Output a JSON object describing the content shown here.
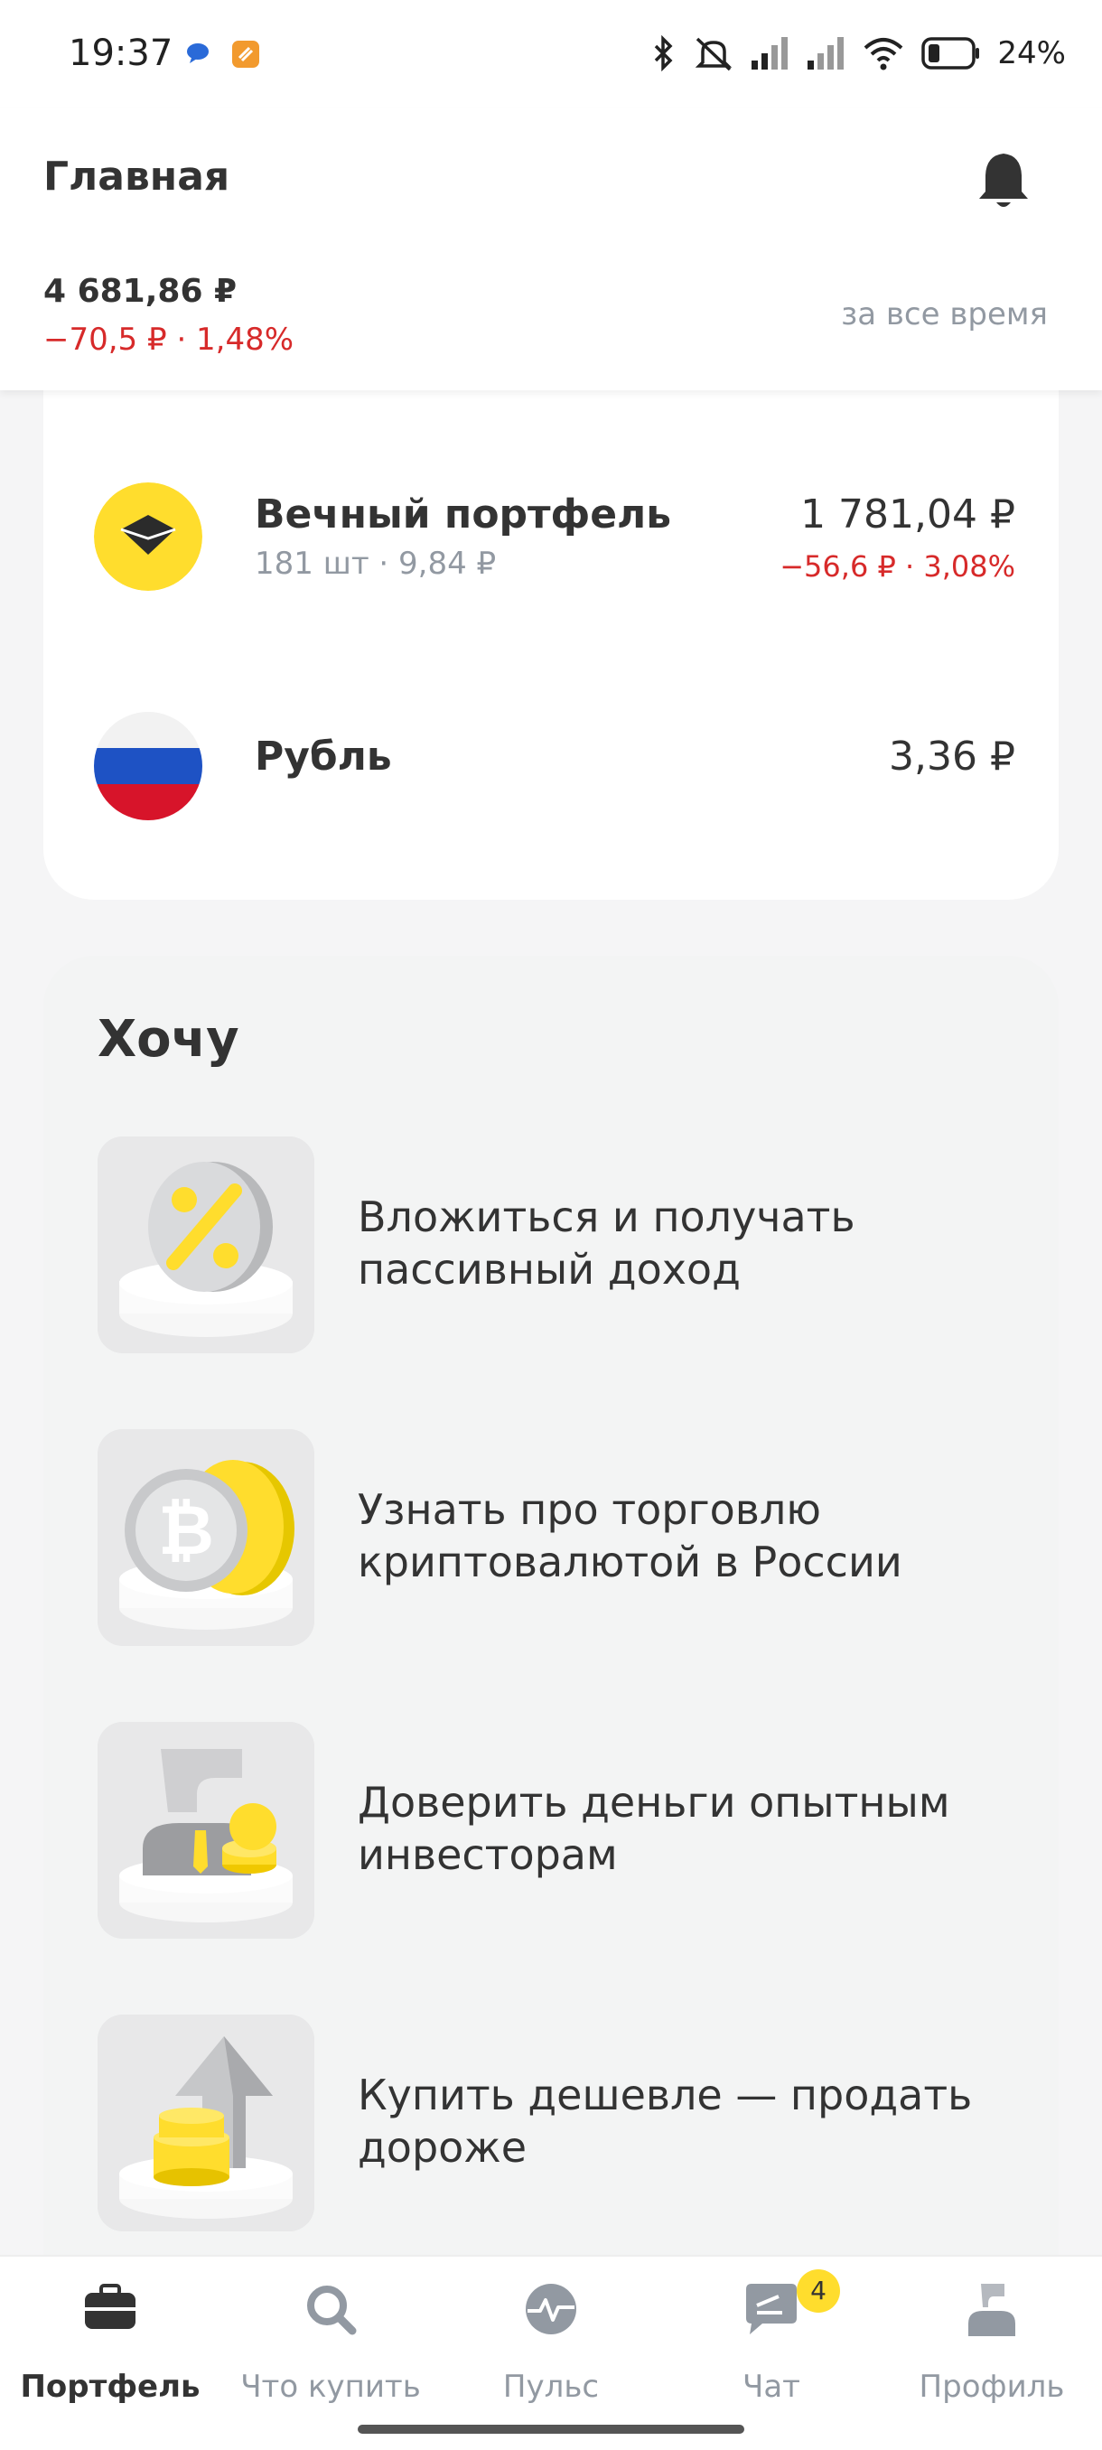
{
  "status_bar": {
    "time": "19:37",
    "battery": "24%",
    "icons": [
      "messages-icon",
      "app-notification-icon",
      "bluetooth-icon",
      "mute-icon",
      "signal-icon",
      "signal-icon",
      "wifi-icon",
      "battery-icon"
    ]
  },
  "header": {
    "title": "Главная",
    "total": "4 681,86 ₽",
    "change": "−70,5 ₽ · 1,48%",
    "period": "за все время"
  },
  "assets": [
    {
      "name": "Вечный портфель",
      "sub": "181 шт · 9,84 ₽",
      "value": "1 781,04 ₽",
      "change": "−56,6 ₽ · 3,08%"
    },
    {
      "name": "Рубль",
      "value": "3,36 ₽"
    }
  ],
  "want": {
    "title": "Хочу",
    "items": [
      {
        "text": "Вложиться и получать пассивный доход",
        "icon": "percent-coin-icon"
      },
      {
        "text": "Узнать про торговлю криптовалютой в России",
        "icon": "bitcoin-coin-icon"
      },
      {
        "text": "Доверить деньги опытным инвесторам",
        "icon": "investor-icon"
      },
      {
        "text": "Купить дешевле — продать дороже",
        "icon": "arrow-up-coins-icon"
      }
    ]
  },
  "nav": {
    "items": [
      {
        "label": "Портфель",
        "icon": "briefcase-icon",
        "active": true
      },
      {
        "label": "Что купить",
        "icon": "search-icon"
      },
      {
        "label": "Пульс",
        "icon": "pulse-icon"
      },
      {
        "label": "Чат",
        "icon": "chat-icon",
        "badge": "4"
      },
      {
        "label": "Профиль",
        "icon": "profile-icon"
      }
    ]
  },
  "colors": {
    "accent": "#ffdd2d",
    "negative": "#d72a2a",
    "muted": "#9299a2"
  }
}
